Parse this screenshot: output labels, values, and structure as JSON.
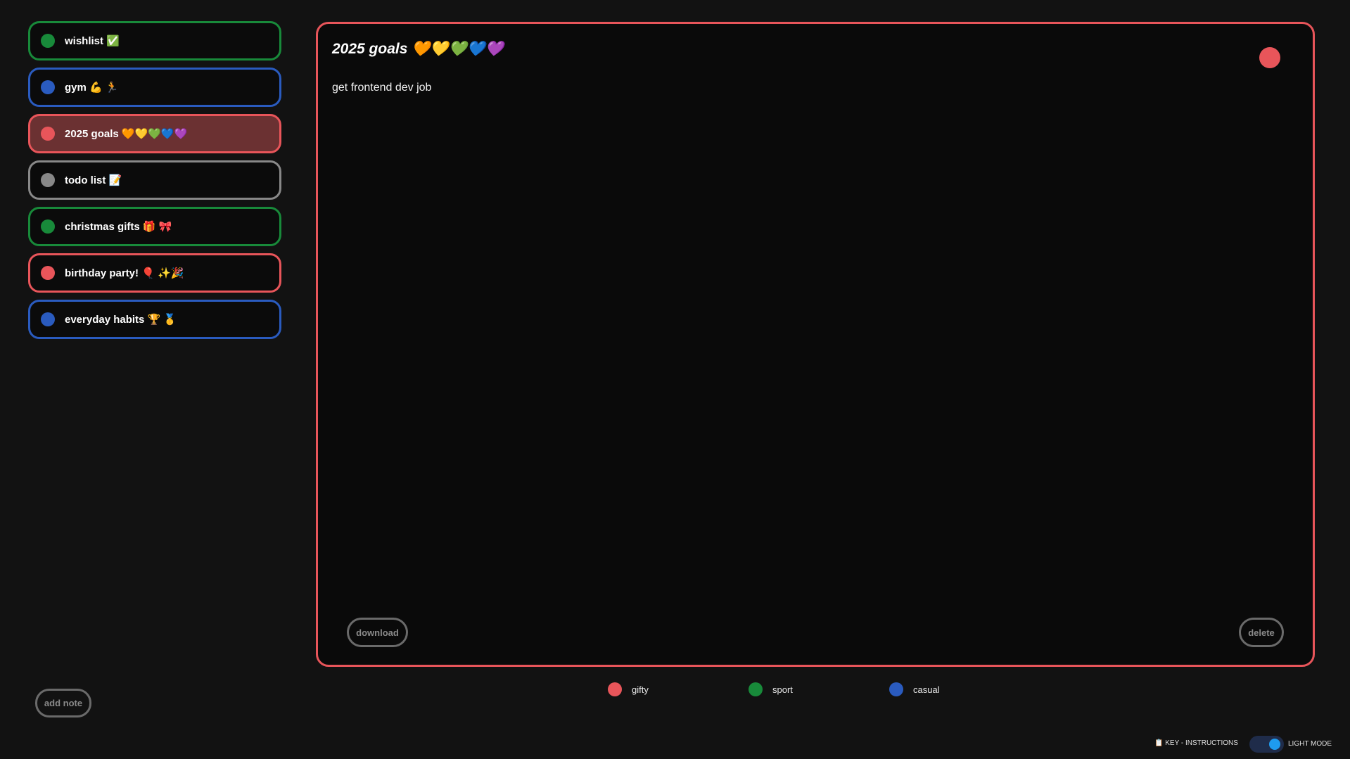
{
  "colors": {
    "gifty": "#e8555a",
    "sport": "#188a3a",
    "casual": "#2a5bbf",
    "neutral": "#888888",
    "active_bg": "#6b3132"
  },
  "sidebar": {
    "items": [
      {
        "label": "wishlist ✅",
        "category": "sport",
        "active": false
      },
      {
        "label": "gym 💪 🏃",
        "category": "casual",
        "active": false
      },
      {
        "label": "2025 goals 🧡💛💚💙💜",
        "category": "gifty",
        "active": true
      },
      {
        "label": "todo list 📝",
        "category": "neutral",
        "active": false
      },
      {
        "label": "christmas gifts 🎁 🎀",
        "category": "sport",
        "active": false
      },
      {
        "label": "birthday party! 🎈 ✨🎉",
        "category": "gifty",
        "active": false
      },
      {
        "label": "everyday habits 🏆 🥇",
        "category": "casual",
        "active": false
      }
    ],
    "add_note_label": "add note"
  },
  "editor": {
    "title": "2025 goals 🧡💛💚💙💜",
    "body": "get frontend dev job",
    "download_label": "download",
    "delete_label": "delete"
  },
  "legend": [
    {
      "label": "gifty",
      "category": "gifty"
    },
    {
      "label": "sport",
      "category": "sport"
    },
    {
      "label": "casual",
      "category": "casual"
    }
  ],
  "footer": {
    "key_label": "📋 KEY - INSTRUCTIONS",
    "toggle_label": "LIGHT MODE"
  }
}
